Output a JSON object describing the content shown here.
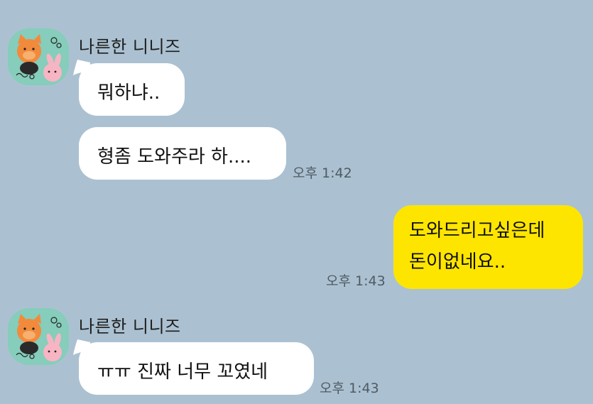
{
  "chat": {
    "messages": [
      {
        "sender": "나른한 니니즈",
        "text": "뭐하냐.."
      },
      {
        "text": "형좀 도와주라 하....",
        "time": "오후 1:42"
      },
      {
        "text_lines": [
          "도와드리고싶은데",
          "돈이없네요.."
        ],
        "time": "오후 1:43"
      },
      {
        "sender": "나른한 니니즈",
        "text": "ㅠㅠ 진짜 너무 꼬였네",
        "time": "오후 1:43"
      }
    ]
  },
  "colors": {
    "background": "#abc1d1",
    "incoming_bubble": "#ffffff",
    "outgoing_bubble": "#fee500",
    "avatar_bg": "#86cdbb"
  },
  "icons": {
    "avatar": "character-avatar-icon"
  }
}
